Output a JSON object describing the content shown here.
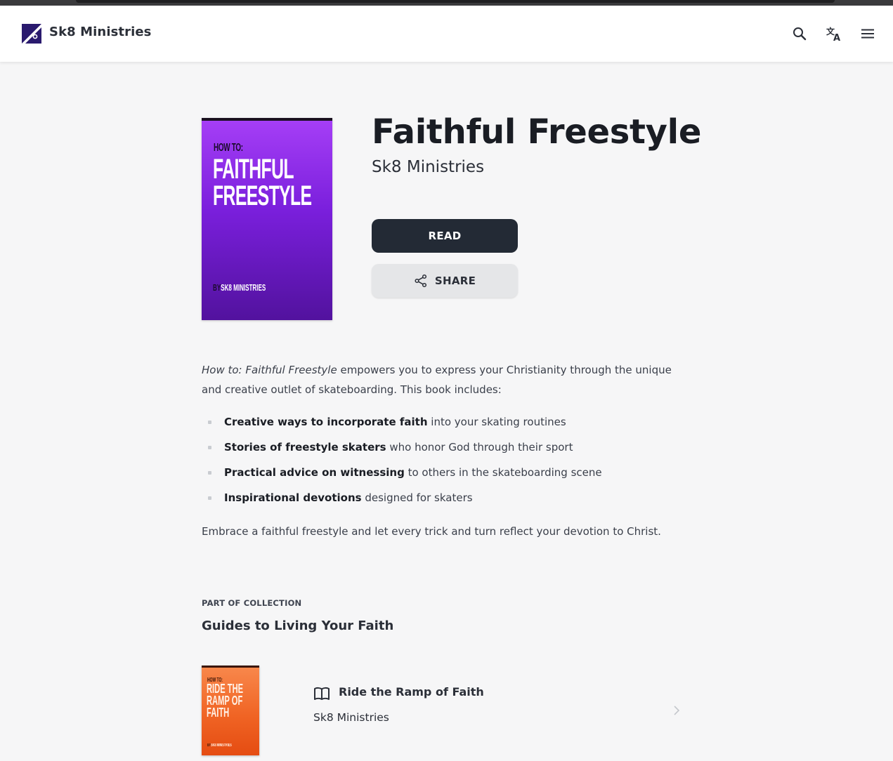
{
  "header": {
    "brand": "Sk8 Ministries",
    "icons": [
      "search-icon",
      "translate-icon",
      "menu-icon"
    ]
  },
  "book": {
    "cover": {
      "top_text": "HOW TO:",
      "title_text": "FAITHFUL\nFREESTYLE",
      "by_prefix": "BY",
      "by_text": "SK8 MINISTRIES"
    },
    "title": "Faithful Freestyle",
    "author": "Sk8 Ministries",
    "read_label": "READ",
    "share_label": "SHARE"
  },
  "description": {
    "intro_italic": "How to: Faithful Freestyle",
    "intro_rest": " empowers you to express your Christianity through the unique and creative outlet of skateboarding. This book includes:",
    "features": [
      {
        "bold": "Creative ways to incorporate faith",
        "rest": " into your skating routines"
      },
      {
        "bold": "Stories of freestyle skaters",
        "rest": " who honor God through their sport"
      },
      {
        "bold": "Practical advice on witnessing",
        "rest": " to others in the skateboarding scene"
      },
      {
        "bold": "Inspirational devotions",
        "rest": " designed for skaters"
      }
    ],
    "closing": "Embrace a faithful freestyle and let every trick and turn reflect your devotion to Christ."
  },
  "collection": {
    "label": "PART OF COLLECTION",
    "title": "Guides to Living Your Faith",
    "items": [
      {
        "cover_top": "HOW TO:",
        "cover_title": "RIDE THE\nRAMP OF\nFAITH",
        "cover_by_prefix": "BY",
        "cover_by": "SK8 MINISTRIES",
        "title": "Ride the Ramp of Faith",
        "author": "Sk8 Ministries"
      }
    ]
  },
  "colors": {
    "primary_button": "#232a35",
    "secondary_button": "#e5e6e8",
    "page_background": "#f6f6f7",
    "cover_purple": "#8b2cf0",
    "cover_orange": "#f06424"
  }
}
